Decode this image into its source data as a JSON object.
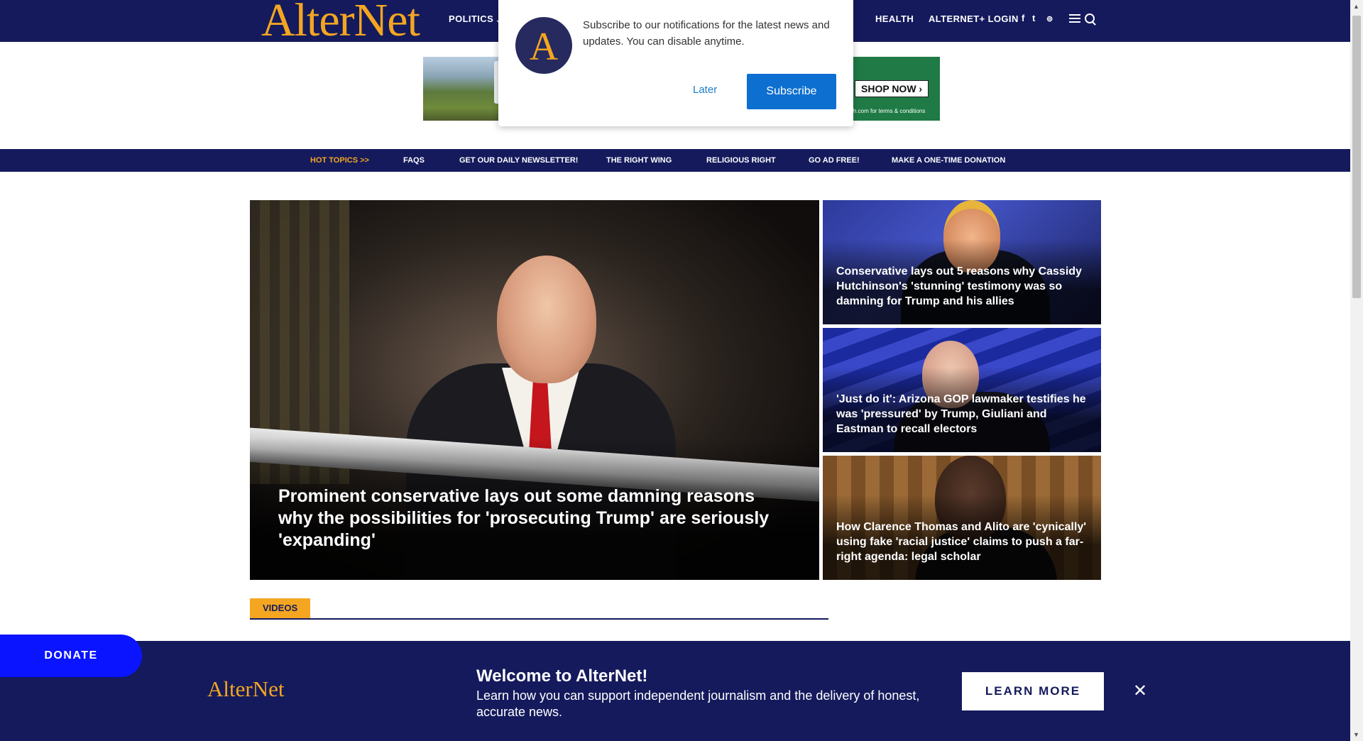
{
  "header": {
    "logo": "AlterNet",
    "nav": [
      {
        "label": "POLITICS",
        "chevron": "⌄"
      },
      {
        "label": "HEALTH"
      },
      {
        "label": "ALTERNET+ LOGIN"
      }
    ],
    "social_icons": [
      "facebook-icon",
      "twitter-icon",
      "rss-icon"
    ],
    "social_glyphs": {
      "facebook": "f",
      "twitter": "t",
      "rss": "⊚"
    }
  },
  "ad": {
    "shop_now": "SHOP NOW ›",
    "terms": "h.com for terms & conditions"
  },
  "notification": {
    "avatar_letter": "A",
    "message": "Subscribe to our notifications for the latest news and updates. You can disable anytime.",
    "later_label": "Later",
    "subscribe_label": "Subscribe"
  },
  "subnav": {
    "items": [
      "HOT TOPICS >>",
      "FAQS",
      "GET OUR DAILY NEWSLETTER!",
      "THE RIGHT WING",
      "RELIGIOUS RIGHT",
      "GO AD FREE!",
      "MAKE A ONE-TIME DONATION"
    ]
  },
  "hero": {
    "title": "Prominent conservative lays out some damning reasons why the possibilities for 'prosecuting Trump' are seriously 'expanding'"
  },
  "side_stories": [
    {
      "title": "Conservative lays out 5 reasons why Cassidy Hutchinson's 'stunning' testimony was so damning for Trump and his allies"
    },
    {
      "title": "'Just do it': Arizona GOP lawmaker testifies he was 'pressured' by Trump, Giuliani and Eastman to recall electors"
    },
    {
      "title": "How Clarence Thomas and Alito are 'cynically' using fake 'racial justice' claims to push a far-right agenda: legal scholar"
    }
  ],
  "videos": {
    "label": "VIDEOS"
  },
  "welcome": {
    "logo": "AlterNet",
    "title": "Welcome to AlterNet!",
    "description": "Learn how you can support independent journalism and the delivery of honest, accurate news.",
    "learn_more": "LEARN MORE",
    "close_glyph": "✕"
  },
  "donate": {
    "label": "DONATE"
  },
  "colors": {
    "navy": "#141a5c",
    "gold": "#f4a621",
    "subscribe_blue": "#0d6fcf",
    "donate_blue": "#0a14ff"
  }
}
